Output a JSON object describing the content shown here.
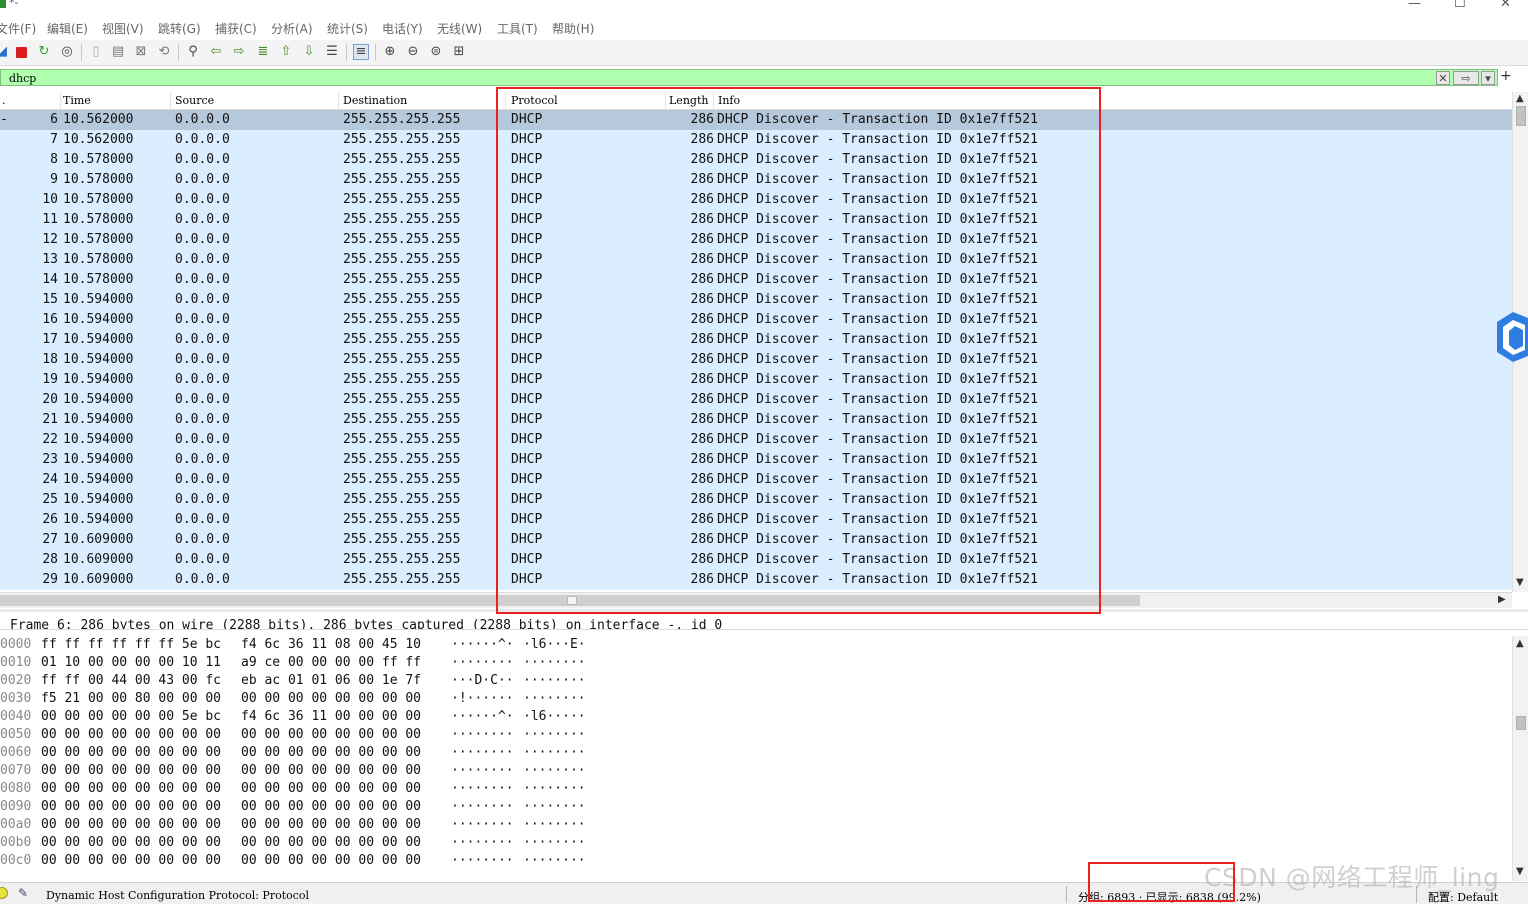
{
  "window": {
    "title": "*-",
    "minimize": "—",
    "maximize": "☐",
    "close": "✕"
  },
  "menu": [
    "文件(F)",
    "编辑(E)",
    "视图(V)",
    "跳转(G)",
    "捕获(C)",
    "分析(A)",
    "统计(S)",
    "电话(Y)",
    "无线(W)",
    "工具(T)",
    "帮助(H)"
  ],
  "toolbar": {
    "icons": [
      "shark-fin-icon",
      "stop-icon",
      "restart-icon",
      "options-icon",
      "open-file-icon",
      "save-file-icon",
      "close-file-icon",
      "reload-icon",
      "find-packet-icon",
      "go-back-icon",
      "go-forward-icon",
      "go-to-packet-icon",
      "first-packet-icon",
      "last-packet-icon",
      "autoscroll-icon",
      "colorize-icon",
      "zoom-in-icon",
      "zoom-out-icon",
      "normal-size-icon",
      "resize-columns-icon"
    ]
  },
  "filter": {
    "value": "dhcp",
    "clear_glyph": "✕",
    "apply_glyph": "⇨",
    "dropdown_glyph": "▾",
    "add_glyph": "+"
  },
  "packet_list": {
    "columns": {
      "no": ".",
      "time": "Time",
      "source": "Source",
      "destination": "Destination",
      "protocol": "Protocol",
      "length": "Length",
      "info": "Info"
    },
    "rows": [
      {
        "no": "6",
        "time": "10.562000",
        "src": "0.0.0.0",
        "dst": "255.255.255.255",
        "proto": "DHCP",
        "len": "286",
        "info": "DHCP Discover - Transaction ID 0x1e7ff521"
      },
      {
        "no": "7",
        "time": "10.562000",
        "src": "0.0.0.0",
        "dst": "255.255.255.255",
        "proto": "DHCP",
        "len": "286",
        "info": "DHCP Discover - Transaction ID 0x1e7ff521"
      },
      {
        "no": "8",
        "time": "10.578000",
        "src": "0.0.0.0",
        "dst": "255.255.255.255",
        "proto": "DHCP",
        "len": "286",
        "info": "DHCP Discover - Transaction ID 0x1e7ff521"
      },
      {
        "no": "9",
        "time": "10.578000",
        "src": "0.0.0.0",
        "dst": "255.255.255.255",
        "proto": "DHCP",
        "len": "286",
        "info": "DHCP Discover - Transaction ID 0x1e7ff521"
      },
      {
        "no": "10",
        "time": "10.578000",
        "src": "0.0.0.0",
        "dst": "255.255.255.255",
        "proto": "DHCP",
        "len": "286",
        "info": "DHCP Discover - Transaction ID 0x1e7ff521"
      },
      {
        "no": "11",
        "time": "10.578000",
        "src": "0.0.0.0",
        "dst": "255.255.255.255",
        "proto": "DHCP",
        "len": "286",
        "info": "DHCP Discover - Transaction ID 0x1e7ff521"
      },
      {
        "no": "12",
        "time": "10.578000",
        "src": "0.0.0.0",
        "dst": "255.255.255.255",
        "proto": "DHCP",
        "len": "286",
        "info": "DHCP Discover - Transaction ID 0x1e7ff521"
      },
      {
        "no": "13",
        "time": "10.578000",
        "src": "0.0.0.0",
        "dst": "255.255.255.255",
        "proto": "DHCP",
        "len": "286",
        "info": "DHCP Discover - Transaction ID 0x1e7ff521"
      },
      {
        "no": "14",
        "time": "10.578000",
        "src": "0.0.0.0",
        "dst": "255.255.255.255",
        "proto": "DHCP",
        "len": "286",
        "info": "DHCP Discover - Transaction ID 0x1e7ff521"
      },
      {
        "no": "15",
        "time": "10.594000",
        "src": "0.0.0.0",
        "dst": "255.255.255.255",
        "proto": "DHCP",
        "len": "286",
        "info": "DHCP Discover - Transaction ID 0x1e7ff521"
      },
      {
        "no": "16",
        "time": "10.594000",
        "src": "0.0.0.0",
        "dst": "255.255.255.255",
        "proto": "DHCP",
        "len": "286",
        "info": "DHCP Discover - Transaction ID 0x1e7ff521"
      },
      {
        "no": "17",
        "time": "10.594000",
        "src": "0.0.0.0",
        "dst": "255.255.255.255",
        "proto": "DHCP",
        "len": "286",
        "info": "DHCP Discover - Transaction ID 0x1e7ff521"
      },
      {
        "no": "18",
        "time": "10.594000",
        "src": "0.0.0.0",
        "dst": "255.255.255.255",
        "proto": "DHCP",
        "len": "286",
        "info": "DHCP Discover - Transaction ID 0x1e7ff521"
      },
      {
        "no": "19",
        "time": "10.594000",
        "src": "0.0.0.0",
        "dst": "255.255.255.255",
        "proto": "DHCP",
        "len": "286",
        "info": "DHCP Discover - Transaction ID 0x1e7ff521"
      },
      {
        "no": "20",
        "time": "10.594000",
        "src": "0.0.0.0",
        "dst": "255.255.255.255",
        "proto": "DHCP",
        "len": "286",
        "info": "DHCP Discover - Transaction ID 0x1e7ff521"
      },
      {
        "no": "21",
        "time": "10.594000",
        "src": "0.0.0.0",
        "dst": "255.255.255.255",
        "proto": "DHCP",
        "len": "286",
        "info": "DHCP Discover - Transaction ID 0x1e7ff521"
      },
      {
        "no": "22",
        "time": "10.594000",
        "src": "0.0.0.0",
        "dst": "255.255.255.255",
        "proto": "DHCP",
        "len": "286",
        "info": "DHCP Discover - Transaction ID 0x1e7ff521"
      },
      {
        "no": "23",
        "time": "10.594000",
        "src": "0.0.0.0",
        "dst": "255.255.255.255",
        "proto": "DHCP",
        "len": "286",
        "info": "DHCP Discover - Transaction ID 0x1e7ff521"
      },
      {
        "no": "24",
        "time": "10.594000",
        "src": "0.0.0.0",
        "dst": "255.255.255.255",
        "proto": "DHCP",
        "len": "286",
        "info": "DHCP Discover - Transaction ID 0x1e7ff521"
      },
      {
        "no": "25",
        "time": "10.594000",
        "src": "0.0.0.0",
        "dst": "255.255.255.255",
        "proto": "DHCP",
        "len": "286",
        "info": "DHCP Discover - Transaction ID 0x1e7ff521"
      },
      {
        "no": "26",
        "time": "10.594000",
        "src": "0.0.0.0",
        "dst": "255.255.255.255",
        "proto": "DHCP",
        "len": "286",
        "info": "DHCP Discover - Transaction ID 0x1e7ff521"
      },
      {
        "no": "27",
        "time": "10.609000",
        "src": "0.0.0.0",
        "dst": "255.255.255.255",
        "proto": "DHCP",
        "len": "286",
        "info": "DHCP Discover - Transaction ID 0x1e7ff521"
      },
      {
        "no": "28",
        "time": "10.609000",
        "src": "0.0.0.0",
        "dst": "255.255.255.255",
        "proto": "DHCP",
        "len": "286",
        "info": "DHCP Discover - Transaction ID 0x1e7ff521"
      },
      {
        "no": "29",
        "time": "10.609000",
        "src": "0.0.0.0",
        "dst": "255.255.255.255",
        "proto": "DHCP",
        "len": "286",
        "info": "DHCP Discover - Transaction ID 0x1e7ff521"
      }
    ],
    "selected_row_marker": "-"
  },
  "detail": {
    "line": "Frame 6: 286 bytes on wire (2288 bits), 286 bytes captured (2288 bits) on interface -, id 0"
  },
  "bytes": [
    {
      "off": "0000",
      "a": "ff ff ff ff ff ff 5e bc",
      "b": "f4 6c 36 11 08 00 45 10",
      "asc_a": "······^·",
      "asc_b": "·l6···E·"
    },
    {
      "off": "0010",
      "a": "01 10 00 00 00 00 10 11",
      "b": "a9 ce 00 00 00 00 ff ff",
      "asc_a": "········",
      "asc_b": "········"
    },
    {
      "off": "0020",
      "a": "ff ff 00 44 00 43 00 fc",
      "b": "eb ac 01 01 06 00 1e 7f",
      "asc_a": "···D·C··",
      "asc_b": "········"
    },
    {
      "off": "0030",
      "a": "f5 21 00 00 80 00 00 00",
      "b": "00 00 00 00 00 00 00 00",
      "asc_a": "·!······",
      "asc_b": "········"
    },
    {
      "off": "0040",
      "a": "00 00 00 00 00 00 5e bc",
      "b": "f4 6c 36 11 00 00 00 00",
      "asc_a": "······^·",
      "asc_b": "·l6·····"
    },
    {
      "off": "0050",
      "a": "00 00 00 00 00 00 00 00",
      "b": "00 00 00 00 00 00 00 00",
      "asc_a": "········",
      "asc_b": "········"
    },
    {
      "off": "0060",
      "a": "00 00 00 00 00 00 00 00",
      "b": "00 00 00 00 00 00 00 00",
      "asc_a": "········",
      "asc_b": "········"
    },
    {
      "off": "0070",
      "a": "00 00 00 00 00 00 00 00",
      "b": "00 00 00 00 00 00 00 00",
      "asc_a": "········",
      "asc_b": "········"
    },
    {
      "off": "0080",
      "a": "00 00 00 00 00 00 00 00",
      "b": "00 00 00 00 00 00 00 00",
      "asc_a": "········",
      "asc_b": "········"
    },
    {
      "off": "0090",
      "a": "00 00 00 00 00 00 00 00",
      "b": "00 00 00 00 00 00 00 00",
      "asc_a": "········",
      "asc_b": "········"
    },
    {
      "off": "00a0",
      "a": "00 00 00 00 00 00 00 00",
      "b": "00 00 00 00 00 00 00 00",
      "asc_a": "········",
      "asc_b": "········"
    },
    {
      "off": "00b0",
      "a": "00 00 00 00 00 00 00 00",
      "b": "00 00 00 00 00 00 00 00",
      "asc_a": "········",
      "asc_b": "········"
    },
    {
      "off": "00c0",
      "a": "00 00 00 00 00 00 00 00",
      "b": "00 00 00 00 00 00 00 00",
      "asc_a": "········",
      "asc_b": "········"
    }
  ],
  "status": {
    "field_text": "Dynamic Host Configuration Protocol: Protocol",
    "packets_text": "分组: 6893 · 已显示: 6838 (99.2%)",
    "profile_text": "配置: Default"
  },
  "watermark": "CSDN @网络工程师_ling",
  "colors": {
    "row_bg": "#daeeff",
    "row_selected_bg": "#b6c8dc",
    "filter_bg": "#afffaf",
    "annotation": "#e8231f"
  }
}
